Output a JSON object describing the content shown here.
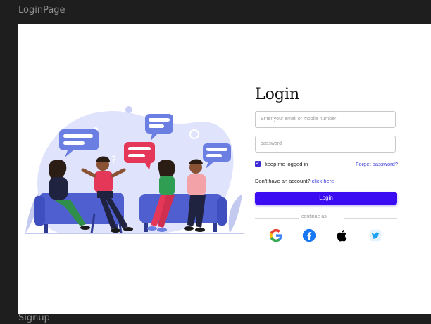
{
  "canvas": {
    "frame_top_label": "LoginPage",
    "frame_bottom_label": "Signup"
  },
  "login": {
    "title": "Login",
    "email_placeholder": "Enter your email  or mobile number",
    "password_placeholder": "password",
    "remember_label": "keep me logged in",
    "remember_checked": true,
    "forgot_label": "Forget password?",
    "signup_prompt": "Don't have an account?",
    "signup_link": "click here",
    "login_button": "Login",
    "continue_label": "continue as"
  },
  "social": [
    {
      "name": "google-icon",
      "color": "#4285F4"
    },
    {
      "name": "facebook-icon",
      "color": "#1877F2"
    },
    {
      "name": "apple-icon",
      "color": "#000000"
    },
    {
      "name": "twitter-icon",
      "color": "#1DA1F2"
    }
  ],
  "colors": {
    "accent": "#3b0cf2",
    "link": "#3b3bd6",
    "illustration_blob": "#dfe3fb"
  }
}
